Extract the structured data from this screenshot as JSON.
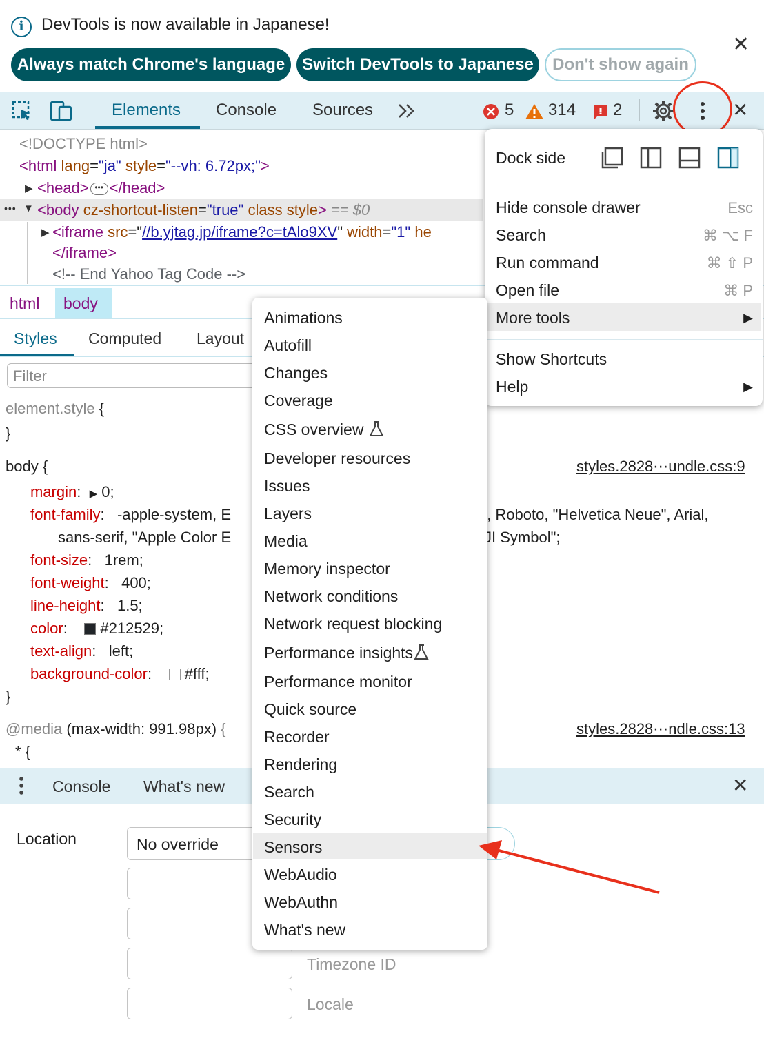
{
  "infobar": {
    "message": "DevTools is now available in Japanese!",
    "btn_match": "Always match Chrome's language",
    "btn_switch": "Switch DevTools to Japanese",
    "btn_dont_show": "Don't show again"
  },
  "toolbar": {
    "tabs": [
      "Elements",
      "Console",
      "Sources"
    ],
    "more_tabs": ">>",
    "errors": "5",
    "warnings": "314",
    "issues": "2"
  },
  "dom": {
    "doctype": "<!DOCTYPE html>",
    "html_open": "<html",
    "html_attr": "lang",
    "html_lang": "\"ja\"",
    "html_attr2": "style",
    "html_style": "\"--vh: 6.72px;\"",
    "html_close": ">",
    "head_open": "<head>",
    "head_close": "</head>",
    "body_open": "<body",
    "body_attr1": "cz-shortcut-listen",
    "body_val1": "\"true\"",
    "body_attr2": "class style",
    "body_close": ">",
    "body_eq": "== $0",
    "iframe_open": "<iframe",
    "iframe_attr": "src",
    "iframe_src": "//b.yjtag.jp/iframe?c=tAlo9XV",
    "iframe_attr2": "width",
    "iframe_width": "\"1\"",
    "iframe_trunc": "he",
    "iframe_close": "</iframe>",
    "comment": "<!-- End Yahoo Tag Code -->"
  },
  "breadcrumbs": [
    "html",
    "body"
  ],
  "style_tabs": [
    "Styles",
    "Computed",
    "Layout"
  ],
  "filter_placeholder": "Filter",
  "styles": {
    "element_style": "element.style",
    "open_brace": "{",
    "close_brace": "}",
    "body_selector": "body",
    "body_source": "styles.2828⋯undle.css:9",
    "props": [
      {
        "name": "margin",
        "value": "0;"
      },
      {
        "name": "font-family",
        "value": "-apple-system, E"
      },
      {
        "name": "font-size",
        "value": "1rem;"
      },
      {
        "name": "font-weight",
        "value": "400;"
      },
      {
        "name": "line-height",
        "value": "1.5;"
      },
      {
        "name": "color",
        "value": "#212529;"
      },
      {
        "name": "text-align",
        "value": "left;"
      },
      {
        "name": "background-color",
        "value": "#fff;"
      }
    ],
    "font_family_cont_left": "sans-serif, \"Apple Color E",
    "font_family_right1": "', Roboto, \"Helvetica Neue\", Arial,",
    "font_family_right2": "JI Symbol\";",
    "color_swatch": "#212529",
    "bg_swatch": "#ffffff",
    "media_at": "@media",
    "media_query": "(max-width: 991.98px)",
    "media_brace": "{",
    "media_source": "styles.2828⋯ndle.css:13",
    "star_rule": "* {"
  },
  "drawer": {
    "tabs": [
      "Console",
      "What's new"
    ],
    "location_label": "Location",
    "location_value": "No override",
    "timezone_placeholder": "Timezone ID",
    "locale_placeholder": "Locale"
  },
  "main_menu": {
    "dock_side": "Dock side",
    "items": [
      {
        "label": "Hide console drawer",
        "shortcut": "Esc"
      },
      {
        "label": "Search",
        "shortcut": "⌘ ⌥ F"
      },
      {
        "label": "Run command",
        "shortcut": "⌘ ⇧ P"
      },
      {
        "label": "Open file",
        "shortcut": "⌘ P"
      },
      {
        "label": "More tools",
        "shortcut": "▶"
      },
      {
        "label": "Show Shortcuts",
        "shortcut": ""
      },
      {
        "label": "Help",
        "shortcut": "▶"
      }
    ]
  },
  "more_tools": [
    "Animations",
    "Autofill",
    "Changes",
    "Coverage",
    "CSS overview",
    "Developer resources",
    "Issues",
    "Layers",
    "Media",
    "Memory inspector",
    "Network conditions",
    "Network request blocking",
    "Performance insights",
    "Performance monitor",
    "Quick source",
    "Recorder",
    "Rendering",
    "Search",
    "Security",
    "Sensors",
    "WebAudio",
    "WebAuthn",
    "What's new"
  ],
  "colors": {
    "accent": "#0b6a8a",
    "pill_fill": "#00565f",
    "toolbar_bg": "#dfeff5",
    "annotation_red": "#e8301c"
  }
}
